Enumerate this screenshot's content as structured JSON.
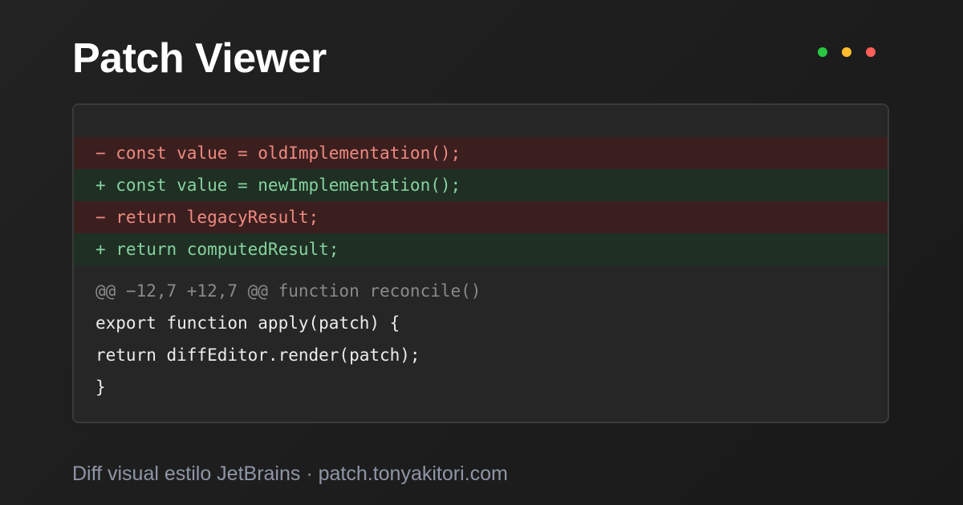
{
  "header": {
    "title": "Patch Viewer"
  },
  "window_dots": [
    {
      "name": "green-dot",
      "color": "#28c840"
    },
    {
      "name": "yellow-dot",
      "color": "#febc2e"
    },
    {
      "name": "red-dot",
      "color": "#ff5f57"
    }
  ],
  "diff": {
    "lines": [
      {
        "type": "removed",
        "text": "− const value = oldImplementation();"
      },
      {
        "type": "added",
        "text": "+ const value = newImplementation();"
      },
      {
        "type": "removed",
        "text": "− return legacyResult;"
      },
      {
        "type": "added",
        "text": "+ return computedResult;"
      }
    ],
    "hunk_header": "@@ −12,7 +12,7 @@ function reconcile()",
    "context": [
      "export function apply(patch) {",
      "return diffEditor.render(patch);",
      "}"
    ]
  },
  "colors": {
    "removed_bg": "#3b1f1f",
    "removed_text": "#ef8a80",
    "added_bg": "#1f2f23",
    "added_text": "#86d3a0"
  },
  "footer": {
    "text": "Diff visual estilo JetBrains · patch.tonyakitori.com"
  }
}
